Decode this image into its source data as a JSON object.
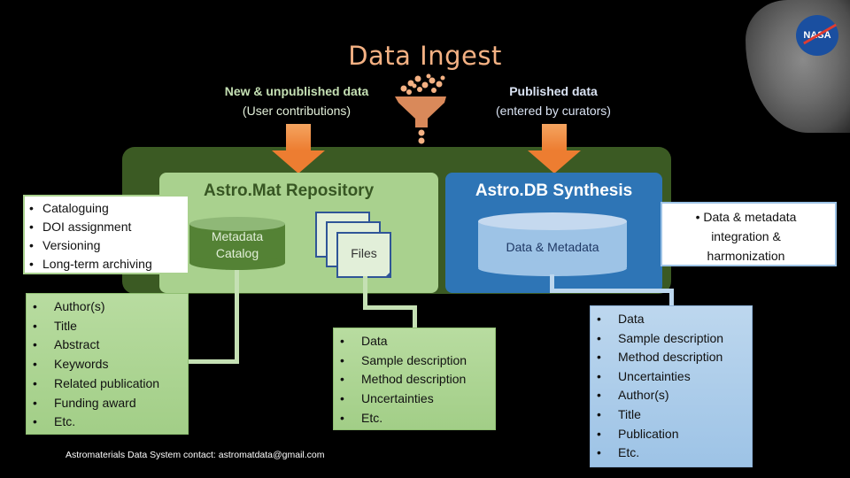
{
  "title": "Data Ingest",
  "sources": {
    "left": {
      "line1": "New & unpublished data",
      "line2": "(User contributions)"
    },
    "right": {
      "line1": "Published data",
      "line2": "(entered by curators)"
    }
  },
  "repository": {
    "title": "Astro.Mat Repository",
    "catalog_line1": "Metadata",
    "catalog_line2": "Catalog",
    "files_label": "Files",
    "functions": [
      "Cataloguing",
      "DOI assignment",
      "Versioning",
      "Long-term archiving"
    ],
    "metadata_fields": [
      "Author(s)",
      "Title",
      "Abstract",
      "Keywords",
      "Related publication",
      "Funding award",
      "Etc."
    ],
    "file_contents": [
      "Data",
      "Sample description",
      "Method description",
      "Uncertainties",
      "Etc."
    ]
  },
  "synthesis": {
    "title": "Astro.DB Synthesis",
    "db_label": "Data & Metadata",
    "function": "• Data & metadata integration & harmonization",
    "function_lines": [
      "• Data & metadata",
      "integration &",
      "harmonization"
    ],
    "contents": [
      "Data",
      "Sample description",
      "Method description",
      "Uncertainties",
      "Author(s)",
      "Title",
      "Publication",
      "Etc."
    ]
  },
  "logo": {
    "text": "NASA"
  },
  "footer": "Astromaterials Data System contact: astromatdata@gmail.com",
  "icons": {
    "funnel": "funnel-icon",
    "arrow": "down-arrow-icon",
    "database": "database-icon",
    "files": "files-icon"
  },
  "colors": {
    "title": "#f4b183",
    "arrow": "#ed7d31",
    "repo": "#a9d18e",
    "synthesis": "#2e75b6",
    "band": "#3b5a23"
  }
}
